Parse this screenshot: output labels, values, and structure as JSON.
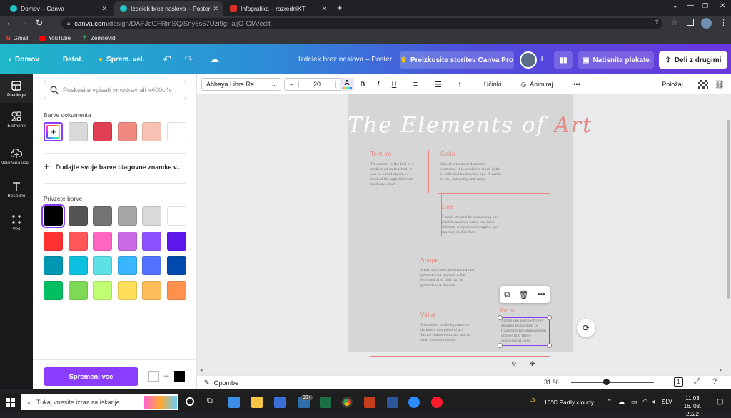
{
  "browser": {
    "tabs": [
      {
        "title": "Domov – Canva",
        "active": false
      },
      {
        "title": "Izdelek brez naslova – Poster",
        "active": true
      },
      {
        "title": "Infografika – razredniKT",
        "active": false
      }
    ],
    "url_host": "canva.com",
    "url_path": "/design/DAFJeGFRmSQ/Sny8s57Uzi9g--aljO-GfA/edit",
    "bookmarks": [
      "Gmail",
      "YouTube",
      "Zemljevidi"
    ]
  },
  "header": {
    "home": "Domov",
    "file": "Datot.",
    "resize": "Sprem. vel.",
    "doc_title": "Izdelek brez naslova – Poster",
    "pro": "Preizkusite storitev Canva Pro",
    "print": "Natisnite plakate",
    "share": "Deli z drugimi"
  },
  "rail": [
    {
      "label": "Predloge",
      "icon": "templates-icon"
    },
    {
      "label": "Elementi",
      "icon": "elements-icon"
    },
    {
      "label": "Naložena vse...",
      "icon": "upload-icon"
    },
    {
      "label": "Besedilo",
      "icon": "text-icon"
    },
    {
      "label": "Več",
      "icon": "more-apps-icon"
    }
  ],
  "panel": {
    "search_placeholder": "Poskusite vpisati »modra« ali »#00c4c",
    "doc_colors_title": "Barve dokumenta",
    "doc_colors": [
      "#d9d9d9",
      "#e03e52",
      "#ef8a80",
      "#f8c2b4",
      "#ffffff"
    ],
    "brand_cta": "Dodajte svoje barve blagovne znamke v...",
    "default_colors_title": "Privzete barve",
    "default_colors": [
      "#000000",
      "#545454",
      "#737373",
      "#a6a6a6",
      "#d9d9d9",
      "#ffffff",
      "#ff3131",
      "#ff5757",
      "#ff66c4",
      "#cb6ce6",
      "#8c52ff",
      "#5e17eb",
      "#0097b2",
      "#0cc0df",
      "#5ce1e6",
      "#38b6ff",
      "#5271ff",
      "#004aad",
      "#00bf63",
      "#7ed957",
      "#c1ff72",
      "#ffde59",
      "#ffbd59",
      "#ff914d"
    ],
    "change_all": "Spremeni vse"
  },
  "toolbar": {
    "font": "Abhaya Libre Re...",
    "size": "20",
    "bold": "B",
    "italic": "I",
    "underline": "U",
    "spacing": "Učinki",
    "animate": "Animiraj",
    "more": "•••",
    "position": "Položaj"
  },
  "poster": {
    "title_main": "The Elements of ",
    "title_accent": "Art",
    "sections": [
      {
        "key": "texture",
        "heading": "Texture",
        "body": "This refers to the feel of a surface when touched. It can be a real object, or implied through different mediums of art."
      },
      {
        "key": "color",
        "heading": "Color",
        "body": "One of art's most dominant elements, it is produced when light is reflected back to the eye. It varies in hue, intensity, and value."
      },
      {
        "key": "line",
        "heading": "Line",
        "body": "A mark created by connecting one point to another. Lines can have different weights and lengths, and can vary in direction."
      },
      {
        "key": "shape",
        "heading": "Shape",
        "body": "A flat, enclosed area that can be geometric or organic A flat, enclosed area that can be geometric or organic."
      },
      {
        "key": "value",
        "heading": "Value",
        "body": "This refers to the lightness or darkness in a piece of art. Value creates contrast, and is used to create depth."
      },
      {
        "key": "form",
        "heading": "Form",
        "body": "Artists use perspective or shading techniques to transform two-dimensional images into three-dimensional ones."
      }
    ]
  },
  "bottom": {
    "notes": "Opombe",
    "zoom": "31 %",
    "zoom_fraction": 0.42
  },
  "taskbar": {
    "search": "Tukaj vnesite izraz za iskanje",
    "weather": "16°C  Partly cloudy",
    "lang": "SLV",
    "time": "11:03",
    "date": "16. 08. 2022",
    "badge": "99+"
  },
  "colors": {
    "accent": "#8b3dff",
    "poster_accent": "#e9857d"
  }
}
